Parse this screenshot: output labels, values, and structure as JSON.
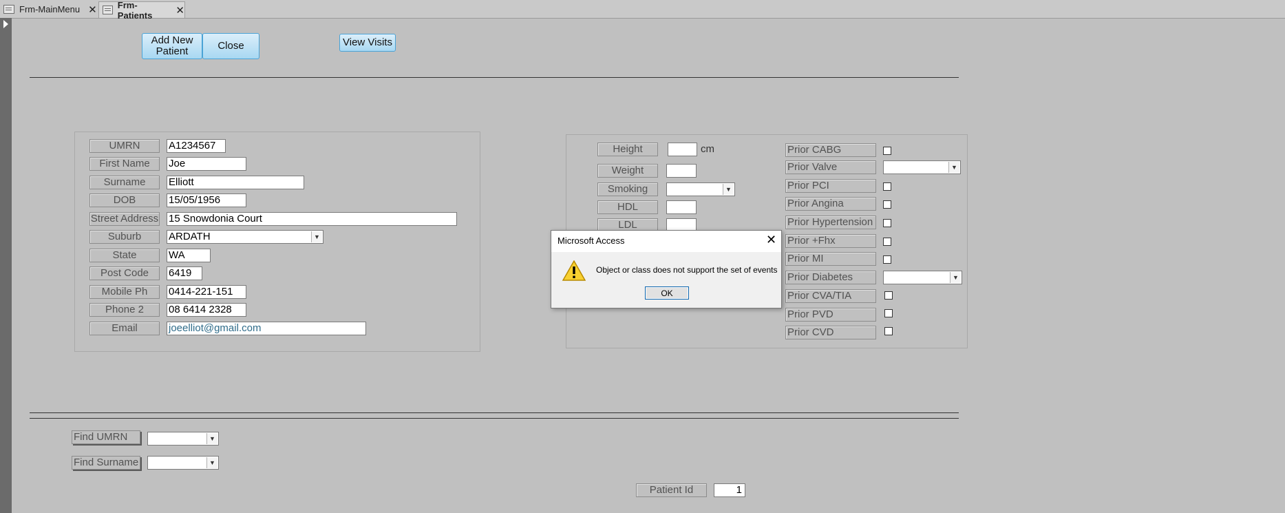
{
  "tabs": [
    {
      "label": "Frm-MainMenu",
      "active": false
    },
    {
      "label": "Frm-Patients",
      "active": true
    }
  ],
  "buttons": {
    "add_new_patient": "Add New Patient",
    "close": "Close",
    "view_visits": "View Visits"
  },
  "patient": {
    "umrn": {
      "label": "UMRN",
      "value": "A1234567"
    },
    "first_name": {
      "label": "First Name",
      "value": "Joe"
    },
    "surname": {
      "label": "Surname",
      "value": "Elliott"
    },
    "dob": {
      "label": "DOB",
      "value": "15/05/1956"
    },
    "street_address": {
      "label": "Street Address",
      "value": "15 Snowdonia Court"
    },
    "suburb": {
      "label": "Suburb",
      "value": "ARDATH"
    },
    "state": {
      "label": "State",
      "value": "WA"
    },
    "post_code": {
      "label": "Post Code",
      "value": "6419"
    },
    "mobile_ph": {
      "label": "Mobile Ph",
      "value": "0414-221-151"
    },
    "phone_2": {
      "label": "Phone 2",
      "value": "08 6414 2328"
    },
    "email": {
      "label": "Email",
      "value": "joeelliot@gmail.com"
    }
  },
  "clinical": {
    "height": {
      "label": "Height",
      "value": "",
      "unit": "cm"
    },
    "weight": {
      "label": "Weight",
      "value": ""
    },
    "smoking": {
      "label": "Smoking",
      "value": ""
    },
    "hdl": {
      "label": "HDL",
      "value": ""
    },
    "ldl": {
      "label": "LDL",
      "value": ""
    }
  },
  "history": {
    "prior_cabg": "Prior CABG",
    "prior_valve": "Prior Valve",
    "prior_pci": "Prior PCI",
    "prior_angina": "Prior Angina",
    "prior_hypertension": "Prior Hypertension",
    "prior_fhx": "Prior +Fhx",
    "prior_mi": "Prior MI",
    "prior_diabetes": "Prior Diabetes",
    "prior_cva_tia": "Prior CVA/TIA",
    "prior_pvd": "Prior PVD",
    "prior_cvd": "Prior CVD"
  },
  "find": {
    "umrn_label": "Find UMRN",
    "surname_label": "Find Surname"
  },
  "patient_id": {
    "label": "Patient Id",
    "value": "1"
  },
  "dialog": {
    "title": "Microsoft Access",
    "message": "Object or class does not support the set of events",
    "ok": "OK"
  },
  "colors": {
    "background": "#c0c0c0",
    "button_fill": "#a8d8f2",
    "email_text": "#2f6c8a"
  }
}
